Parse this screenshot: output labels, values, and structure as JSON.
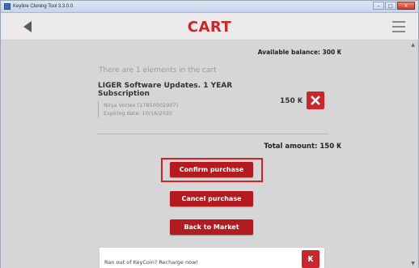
{
  "window": {
    "title": "Keyline Cloning Tool 3.3.0.0",
    "controls": [
      "–",
      "□",
      "✕"
    ]
  },
  "header": {
    "title": "CART",
    "back_icon": "chevron-left-icon",
    "menu_icon": "hamburger-icon"
  },
  "cart": {
    "balance": "Available balance: 300 ₭",
    "elements_count": "There are 1 elements in the cart",
    "item": {
      "name": "LIGER Software Updates. 1 YEAR Subscription",
      "device": "Ninja Vortex (17850002907)",
      "expiry": "Expiring date: 10/16/2020",
      "price": "150 ₭",
      "remove_icon": "close-icon"
    },
    "total": "Total amount: 150 ₭"
  },
  "actions": {
    "confirm": "Confirm purchase",
    "cancel": "Cancel purchase",
    "back": "Back to Market"
  },
  "recharge": {
    "text": "Ran out of KeyCoin? Recharge now!",
    "logo_text": "₭"
  },
  "colors": {
    "accent": "#c8272d",
    "button": "#b31b20",
    "background": "#d6d6d6"
  }
}
